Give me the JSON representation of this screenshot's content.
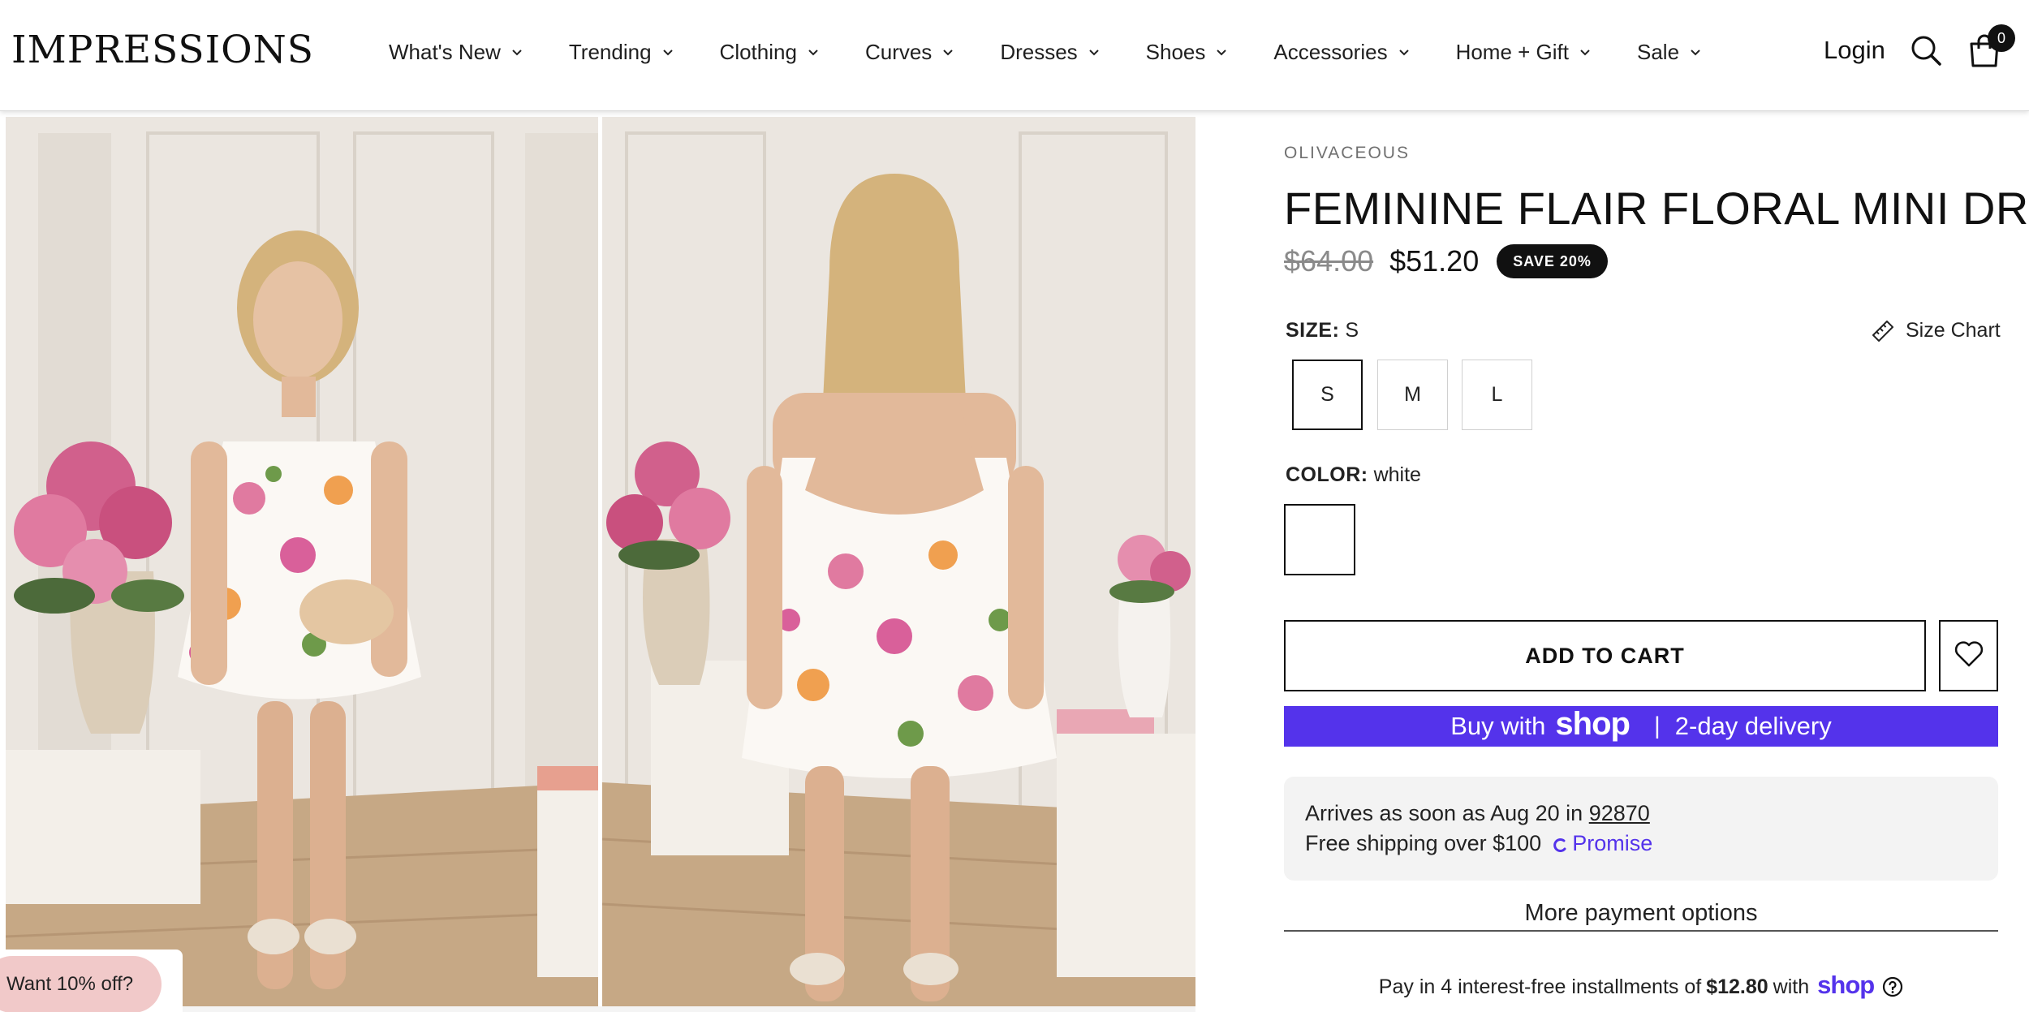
{
  "header": {
    "logo": "IMPRESSIONS",
    "nav": [
      {
        "label": "What's New"
      },
      {
        "label": "Trending"
      },
      {
        "label": "Clothing"
      },
      {
        "label": "Curves"
      },
      {
        "label": "Dresses"
      },
      {
        "label": "Shoes"
      },
      {
        "label": "Accessories"
      },
      {
        "label": "Home + Gift"
      },
      {
        "label": "Sale"
      }
    ],
    "login": "Login",
    "cart_count": "0",
    "icons": {
      "search": "search-icon",
      "cart": "shopping-bag-icon",
      "nav_chevron": "chevron-down-icon"
    }
  },
  "gallery": {
    "images": [
      {
        "alt": "Front view of floral mini dress"
      },
      {
        "alt": "Back view of floral mini dress"
      }
    ]
  },
  "promo": {
    "label": "Want 10% off?"
  },
  "product": {
    "brand": "OLIVACEOUS",
    "title": "FEMININE FLAIR FLORAL MINI DRESS",
    "price_original": "$64.00",
    "price_sale": "$51.20",
    "save_badge": "SAVE 20%",
    "size_label": "SIZE:",
    "size_selected": "S",
    "size_chart": "Size Chart",
    "sizes": [
      "S",
      "M",
      "L"
    ],
    "color_label": "COLOR:",
    "color_selected": "white",
    "add_to_cart": "ADD TO CART",
    "shop_pay": {
      "prefix": "Buy with",
      "brand": "shop",
      "separator": "|",
      "suffix": "2-day delivery"
    },
    "delivery": {
      "line1_prefix": "Arrives as soon as Aug 20 in",
      "zip": "92870",
      "line2": "Free shipping over $100",
      "promise": "Promise"
    },
    "more_payment": "More payment options",
    "installments": {
      "prefix": "Pay in 4 interest-free installments of",
      "amount": "$12.80",
      "with": "with",
      "brand": "shop"
    }
  },
  "colors": {
    "shop_purple": "#5433eb",
    "promo_pink": "#f1c9c9",
    "badge": "#111111"
  }
}
